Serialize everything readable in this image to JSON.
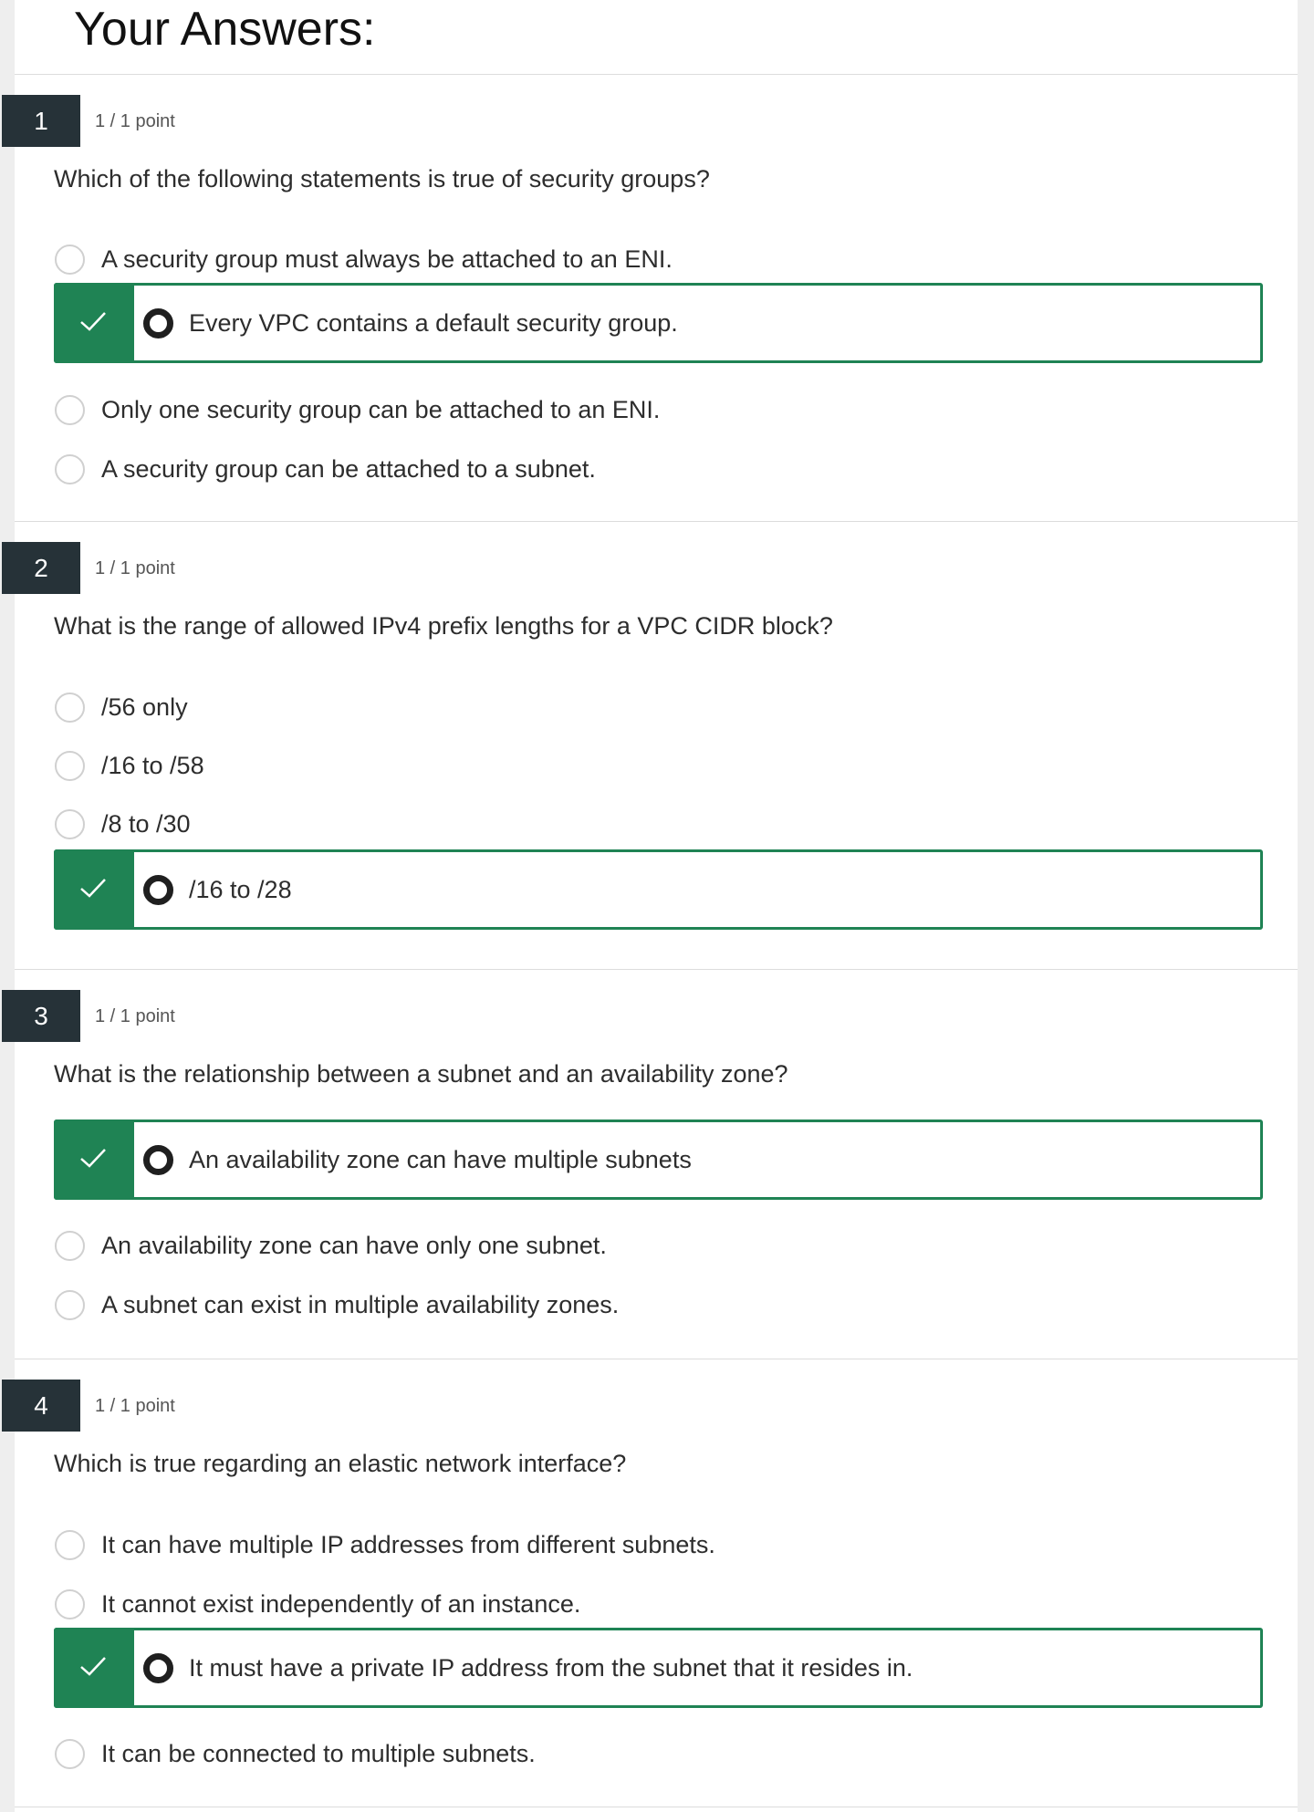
{
  "page": {
    "title": "Your Answers:"
  },
  "questions": [
    {
      "number": "1",
      "score": "1 / 1 point",
      "prompt": "Which of the following statements is true of security groups?",
      "options": [
        {
          "label": "A security group must always be attached to an ENI.",
          "correct": false
        },
        {
          "label": "Every VPC contains a default security group.",
          "correct": true,
          "selected": true
        },
        {
          "label": "Only one security group can be attached to an ENI.",
          "correct": false
        },
        {
          "label": "A security group can be attached to a subnet.",
          "correct": false
        }
      ]
    },
    {
      "number": "2",
      "score": "1 / 1 point",
      "prompt": "What is the range of allowed IPv4 prefix lengths for a VPC CIDR block?",
      "options": [
        {
          "label": "/56 only",
          "correct": false
        },
        {
          "label": "/16 to /58",
          "correct": false
        },
        {
          "label": "/8 to /30",
          "correct": false
        },
        {
          "label": "/16 to /28",
          "correct": true,
          "selected": true
        }
      ]
    },
    {
      "number": "3",
      "score": "1 / 1 point",
      "prompt": "What is the relationship between a subnet and an availability zone?",
      "options": [
        {
          "label": "An availability zone can have multiple subnets",
          "correct": true,
          "selected": true
        },
        {
          "label": "An availability zone can have only one subnet.",
          "correct": false
        },
        {
          "label": "A subnet can exist in multiple availability zones.",
          "correct": false
        }
      ]
    },
    {
      "number": "4",
      "score": "1 / 1 point",
      "prompt": "Which is true regarding an elastic network interface?",
      "options": [
        {
          "label": "It can have multiple IP addresses from different subnets.",
          "correct": false
        },
        {
          "label": "It cannot exist independently of an instance.",
          "correct": false
        },
        {
          "label": "It must have a private IP address from the subnet that it resides in.",
          "correct": true,
          "selected": true
        },
        {
          "label": "It can be connected to multiple subnets.",
          "correct": false
        }
      ]
    }
  ],
  "colors": {
    "correct_green": "#1f8354",
    "question_number_bg": "#263238",
    "page_bg": "#eeeeee",
    "divider": "#dcdcdc"
  },
  "icons": {
    "correct_marker": "checkmark-icon",
    "unselected_option": "radio-unselected-icon",
    "selected_option": "radio-selected-icon"
  }
}
